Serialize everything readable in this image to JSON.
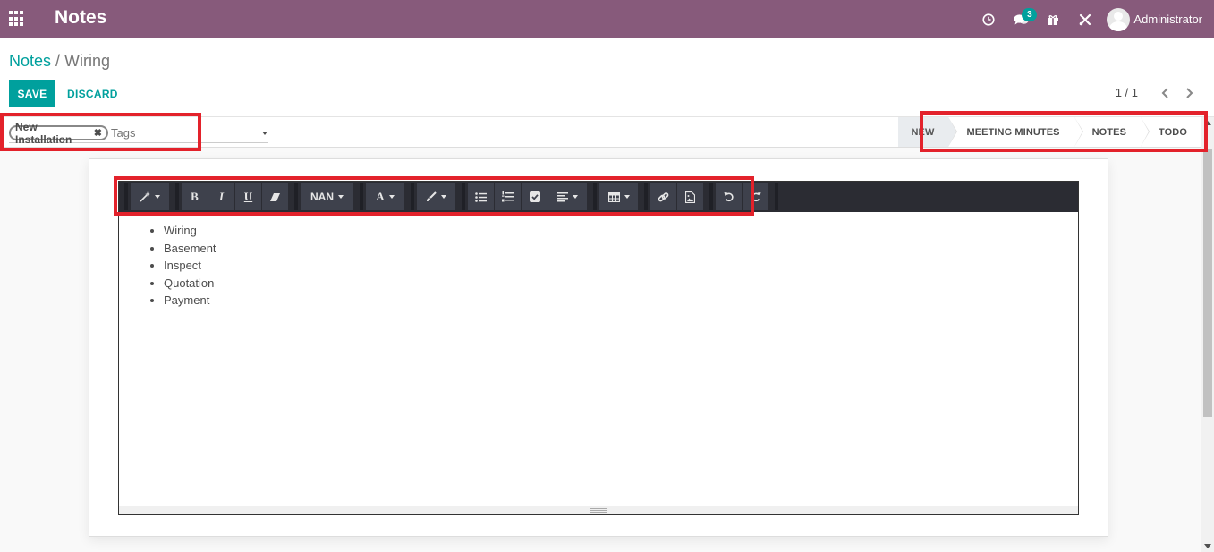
{
  "navbar": {
    "app_title": "Notes",
    "messages_badge": "3",
    "user_name": "Administrator",
    "bg_color": "#875a7b",
    "icons": [
      "apps-grid-icon",
      "clock-icon",
      "chat-icon",
      "gift-icon",
      "tools-icon"
    ]
  },
  "breadcrumb": {
    "parent": "Notes",
    "separator": "/",
    "current": "Wiring"
  },
  "buttons": {
    "save": "SAVE",
    "discard": "DISCARD"
  },
  "pager": {
    "value": "1 / 1"
  },
  "tags": {
    "chip": "New Installation",
    "placeholder": "Tags"
  },
  "stages": [
    {
      "label": "NEW",
      "active": true
    },
    {
      "label": "MEETING MINUTES",
      "active": false
    },
    {
      "label": "NOTES",
      "active": false
    },
    {
      "label": "TODO",
      "active": false
    }
  ],
  "toolbar": {
    "font_size": "NAN",
    "bold": "B",
    "italic": "I",
    "underline": "U",
    "font_color": "A"
  },
  "note": {
    "items": [
      "Wiring",
      "Basement",
      "Inspect",
      "Quotation",
      "Payment"
    ]
  },
  "colors": {
    "accent": "#00a09d",
    "highlight": "#e3222b"
  }
}
